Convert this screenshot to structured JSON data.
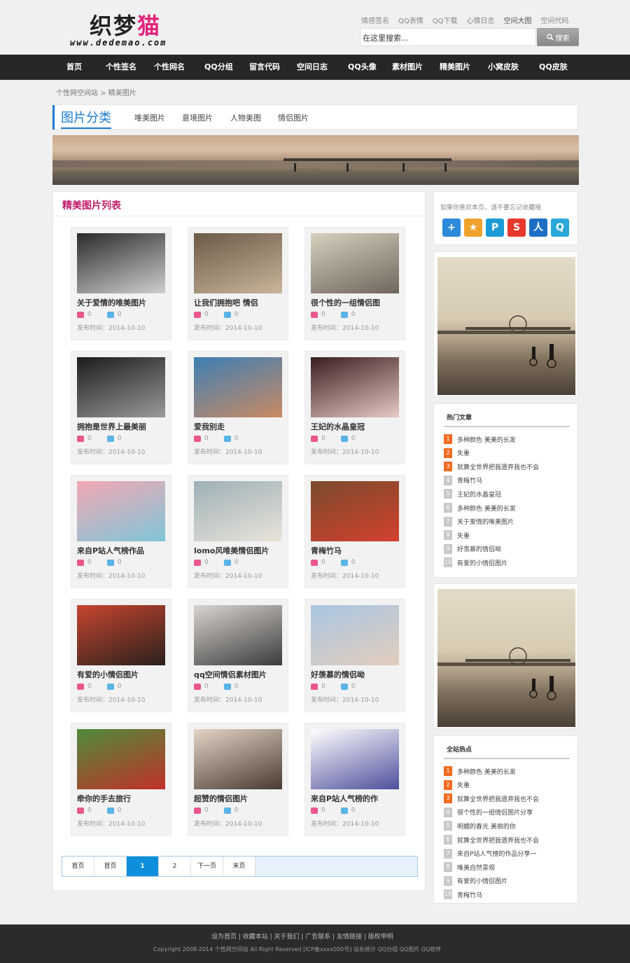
{
  "header": {
    "logo_cn_main": "织梦",
    "logo_cn_accent": "猫",
    "logo_en": "www.dedemao.com",
    "top_links": [
      "情感签名",
      "QQ表情",
      "QQ下载",
      "心情日志",
      "空间大图",
      "空间代码"
    ],
    "search_placeholder": "在这里搜索...",
    "search_button": "搜索"
  },
  "nav": [
    "首页",
    "个性签名",
    "个性网名",
    "QQ分组",
    "留言代码",
    "空间日志",
    "QQ头像",
    "素材图片",
    "精美图片",
    "小窝皮肤",
    "QQ皮肤"
  ],
  "breadcrumb": {
    "home": "个性网空间站",
    "sep": ">",
    "current": "精美图片"
  },
  "category": {
    "title": "图片分类",
    "links": [
      "唯美图片",
      "意境图片",
      "人物美图",
      "情侣图片"
    ]
  },
  "main": {
    "title": "精美图片列表",
    "cards": [
      {
        "title": "关于爱情的唯美图片",
        "likes": "0",
        "dislikes": "0",
        "date": "发布时间：2014-10-10",
        "c1": "#2b2b2b",
        "c2": "#cfcfcf"
      },
      {
        "title": "让我们拥抱吧 情侣",
        "likes": "0",
        "dislikes": "0",
        "date": "发布时间：2014-10-10",
        "c1": "#6b5a48",
        "c2": "#c9b59b"
      },
      {
        "title": "很个性的一组情侣图",
        "likes": "0",
        "dislikes": "0",
        "date": "发布时间：2014-10-10",
        "c1": "#d6d0bf",
        "c2": "#6e665b"
      },
      {
        "title": "拥抱是世界上最美丽",
        "likes": "0",
        "dislikes": "0",
        "date": "发布时间：2014-10-10",
        "c1": "#1c1c1c",
        "c2": "#9a9a9a"
      },
      {
        "title": "爱我别走",
        "likes": "0",
        "dislikes": "0",
        "date": "发布时间：2014-10-10",
        "c1": "#3e7fb4",
        "c2": "#c98a63"
      },
      {
        "title": "王妃的水晶皇冠",
        "likes": "0",
        "dislikes": "0",
        "date": "发布时间：2014-10-10",
        "c1": "#3a1e1e",
        "c2": "#e7c9c4"
      },
      {
        "title": "来自P站人气榜作品",
        "likes": "0",
        "dislikes": "0",
        "date": "发布时间：2014-10-10",
        "c1": "#f3a7b3",
        "c2": "#7fc6d8"
      },
      {
        "title": "lomo风唯美情侣图片",
        "likes": "0",
        "dislikes": "0",
        "date": "发布时间：2014-10-10",
        "c1": "#9db0b6",
        "c2": "#e9e4da"
      },
      {
        "title": "青梅竹马",
        "likes": "0",
        "dislikes": "0",
        "date": "发布时间：2014-10-10",
        "c1": "#7a4b2c",
        "c2": "#d3402f"
      },
      {
        "title": "有爱的小情侣图片",
        "likes": "0",
        "dislikes": "0",
        "date": "发布时间：2014-10-10",
        "c1": "#c6452f",
        "c2": "#2a211d"
      },
      {
        "title": "qq空间情侣素材图片",
        "likes": "0",
        "dislikes": "0",
        "date": "发布时间：2014-10-10",
        "c1": "#d9d4cf",
        "c2": "#3b3b3b"
      },
      {
        "title": "好羡慕的情侣呦",
        "likes": "0",
        "dislikes": "0",
        "date": "发布时间：2014-10-10",
        "c1": "#a9c6e2",
        "c2": "#e3cdbd"
      },
      {
        "title": "牵你的手去旅行",
        "likes": "0",
        "dislikes": "0",
        "date": "发布时间：2014-10-10",
        "c1": "#4f8c3a",
        "c2": "#c0302a"
      },
      {
        "title": "超赞的情侣图片",
        "likes": "0",
        "dislikes": "0",
        "date": "发布时间：2014-10-10",
        "c1": "#e3d4c6",
        "c2": "#4a3b32"
      },
      {
        "title": "来自P站人气榜的作",
        "likes": "0",
        "dislikes": "0",
        "date": "发布时间：2014-10-10",
        "c1": "#ffffff",
        "c2": "#4e4f9c"
      }
    ]
  },
  "pager": [
    "首页",
    "首页",
    "1",
    "2",
    "下一页",
    "末页"
  ],
  "sidebar": {
    "share_text": "如果你喜欢本页，请不要忘记收藏哦",
    "share_icons": [
      {
        "name": "add-share-icon",
        "glyph": "+",
        "color": "#2d8ad8"
      },
      {
        "name": "qzone-share-icon",
        "glyph": "★",
        "color": "#f0a22c"
      },
      {
        "name": "tencent-weibo-share-icon",
        "glyph": "P",
        "color": "#1c9cd6"
      },
      {
        "name": "sina-weibo-share-icon",
        "glyph": "S",
        "color": "#e6392b"
      },
      {
        "name": "renren-share-icon",
        "glyph": "人",
        "color": "#1e6fc4"
      },
      {
        "name": "kaixin-share-icon",
        "glyph": "Q",
        "color": "#2aa8d9"
      }
    ],
    "hot_title": "热门文章",
    "hot_items": [
      "多种颜色 美美的长发",
      "失重",
      "就算全世界把我遗弃我也不会",
      "青梅竹马",
      "王妃的水晶皇冠",
      "多种颜色 美美的长发",
      "关于爱情的唯美图片",
      "失重",
      "好羡慕的情侣呦",
      "有爱的小情侣图片"
    ],
    "site_title": "全站热点",
    "site_items": [
      "多种颜色 美美的长发",
      "失重",
      "就算全世界把我遗弃我也不会",
      "很个性的一组情侣图片分享",
      "明媚的春光 美丽的你",
      "就算全世界把我遗弃我也不会",
      "来自P站人气榜的作品分享一",
      "唯美自然景观",
      "有爱的小情侣图片",
      "青梅竹马"
    ],
    "num_labels": [
      "1",
      "2",
      "3",
      "4",
      "5",
      "6",
      "7",
      "8",
      "9",
      "10"
    ]
  },
  "footer": {
    "links": "设为首页 | 收藏本站 | 关于我们 | 广告联系 | 友情链接 | 版权申明",
    "copyright": "Copyright 2008-2014 个性网空间站 All Right Reserved [ICP备xxxx000号] 站长统计 QQ分组 QQ图片 QQ软件"
  }
}
